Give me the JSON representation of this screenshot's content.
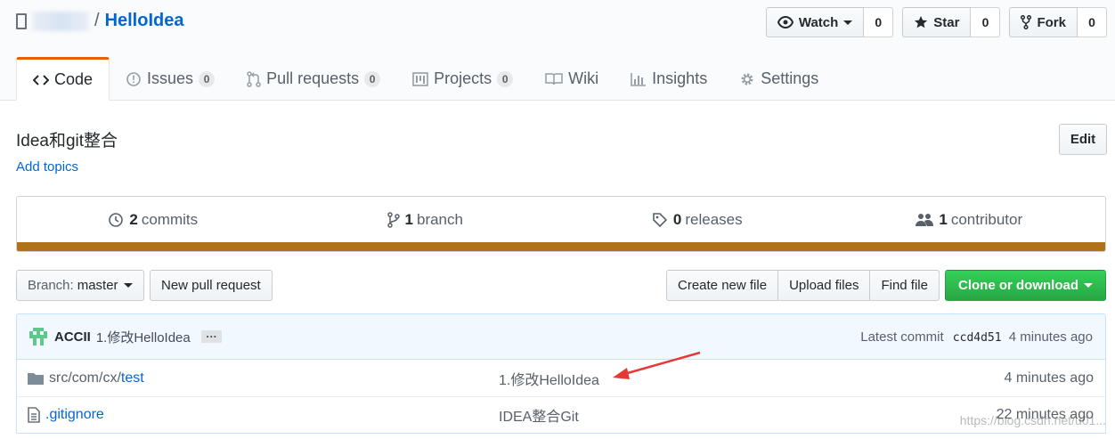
{
  "repo": {
    "slash": "/",
    "name": "HelloIdea"
  },
  "actions": {
    "watch": {
      "label": "Watch",
      "count": "0"
    },
    "star": {
      "label": "Star",
      "count": "0"
    },
    "fork": {
      "label": "Fork",
      "count": "0"
    }
  },
  "tabs": [
    {
      "label": "Code",
      "icon": "code-icon"
    },
    {
      "label": "Issues",
      "count": "0",
      "icon": "issue-icon"
    },
    {
      "label": "Pull requests",
      "count": "0",
      "icon": "pull-request-icon"
    },
    {
      "label": "Projects",
      "count": "0",
      "icon": "project-icon"
    },
    {
      "label": "Wiki",
      "icon": "book-icon"
    },
    {
      "label": "Insights",
      "icon": "graph-icon"
    },
    {
      "label": "Settings",
      "icon": "gear-icon"
    }
  ],
  "description": "Idea和git整合",
  "add_topics": "Add topics",
  "edit_label": "Edit",
  "summary": {
    "commits": {
      "num": "2",
      "label": "commits"
    },
    "branches": {
      "num": "1",
      "label": "branch"
    },
    "releases": {
      "num": "0",
      "label": "releases"
    },
    "contributors": {
      "num": "1",
      "label": "contributor"
    }
  },
  "language_color": "#b07219",
  "toolbar": {
    "branch_prefix": "Branch:",
    "branch_name": "master",
    "new_pr": "New pull request",
    "create_file": "Create new file",
    "upload_files": "Upload files",
    "find_file": "Find file",
    "clone": "Clone or download"
  },
  "commit": {
    "author": "ACCII",
    "message": "1.修改HelloIdea",
    "ellipsis": "…",
    "latest_label": "Latest commit",
    "sha": "ccd4d51",
    "age": "4 minutes ago"
  },
  "files": [
    {
      "prefix": "src/com/cx/",
      "name": "test",
      "type": "folder",
      "message": "1.修改HelloIdea",
      "age": "4 minutes ago"
    },
    {
      "prefix": "",
      "name": ".gitignore",
      "type": "file",
      "message": "IDEA整合Git",
      "age": "22 minutes ago"
    }
  ],
  "watermark": "https://blog.csdn.net/u01..."
}
